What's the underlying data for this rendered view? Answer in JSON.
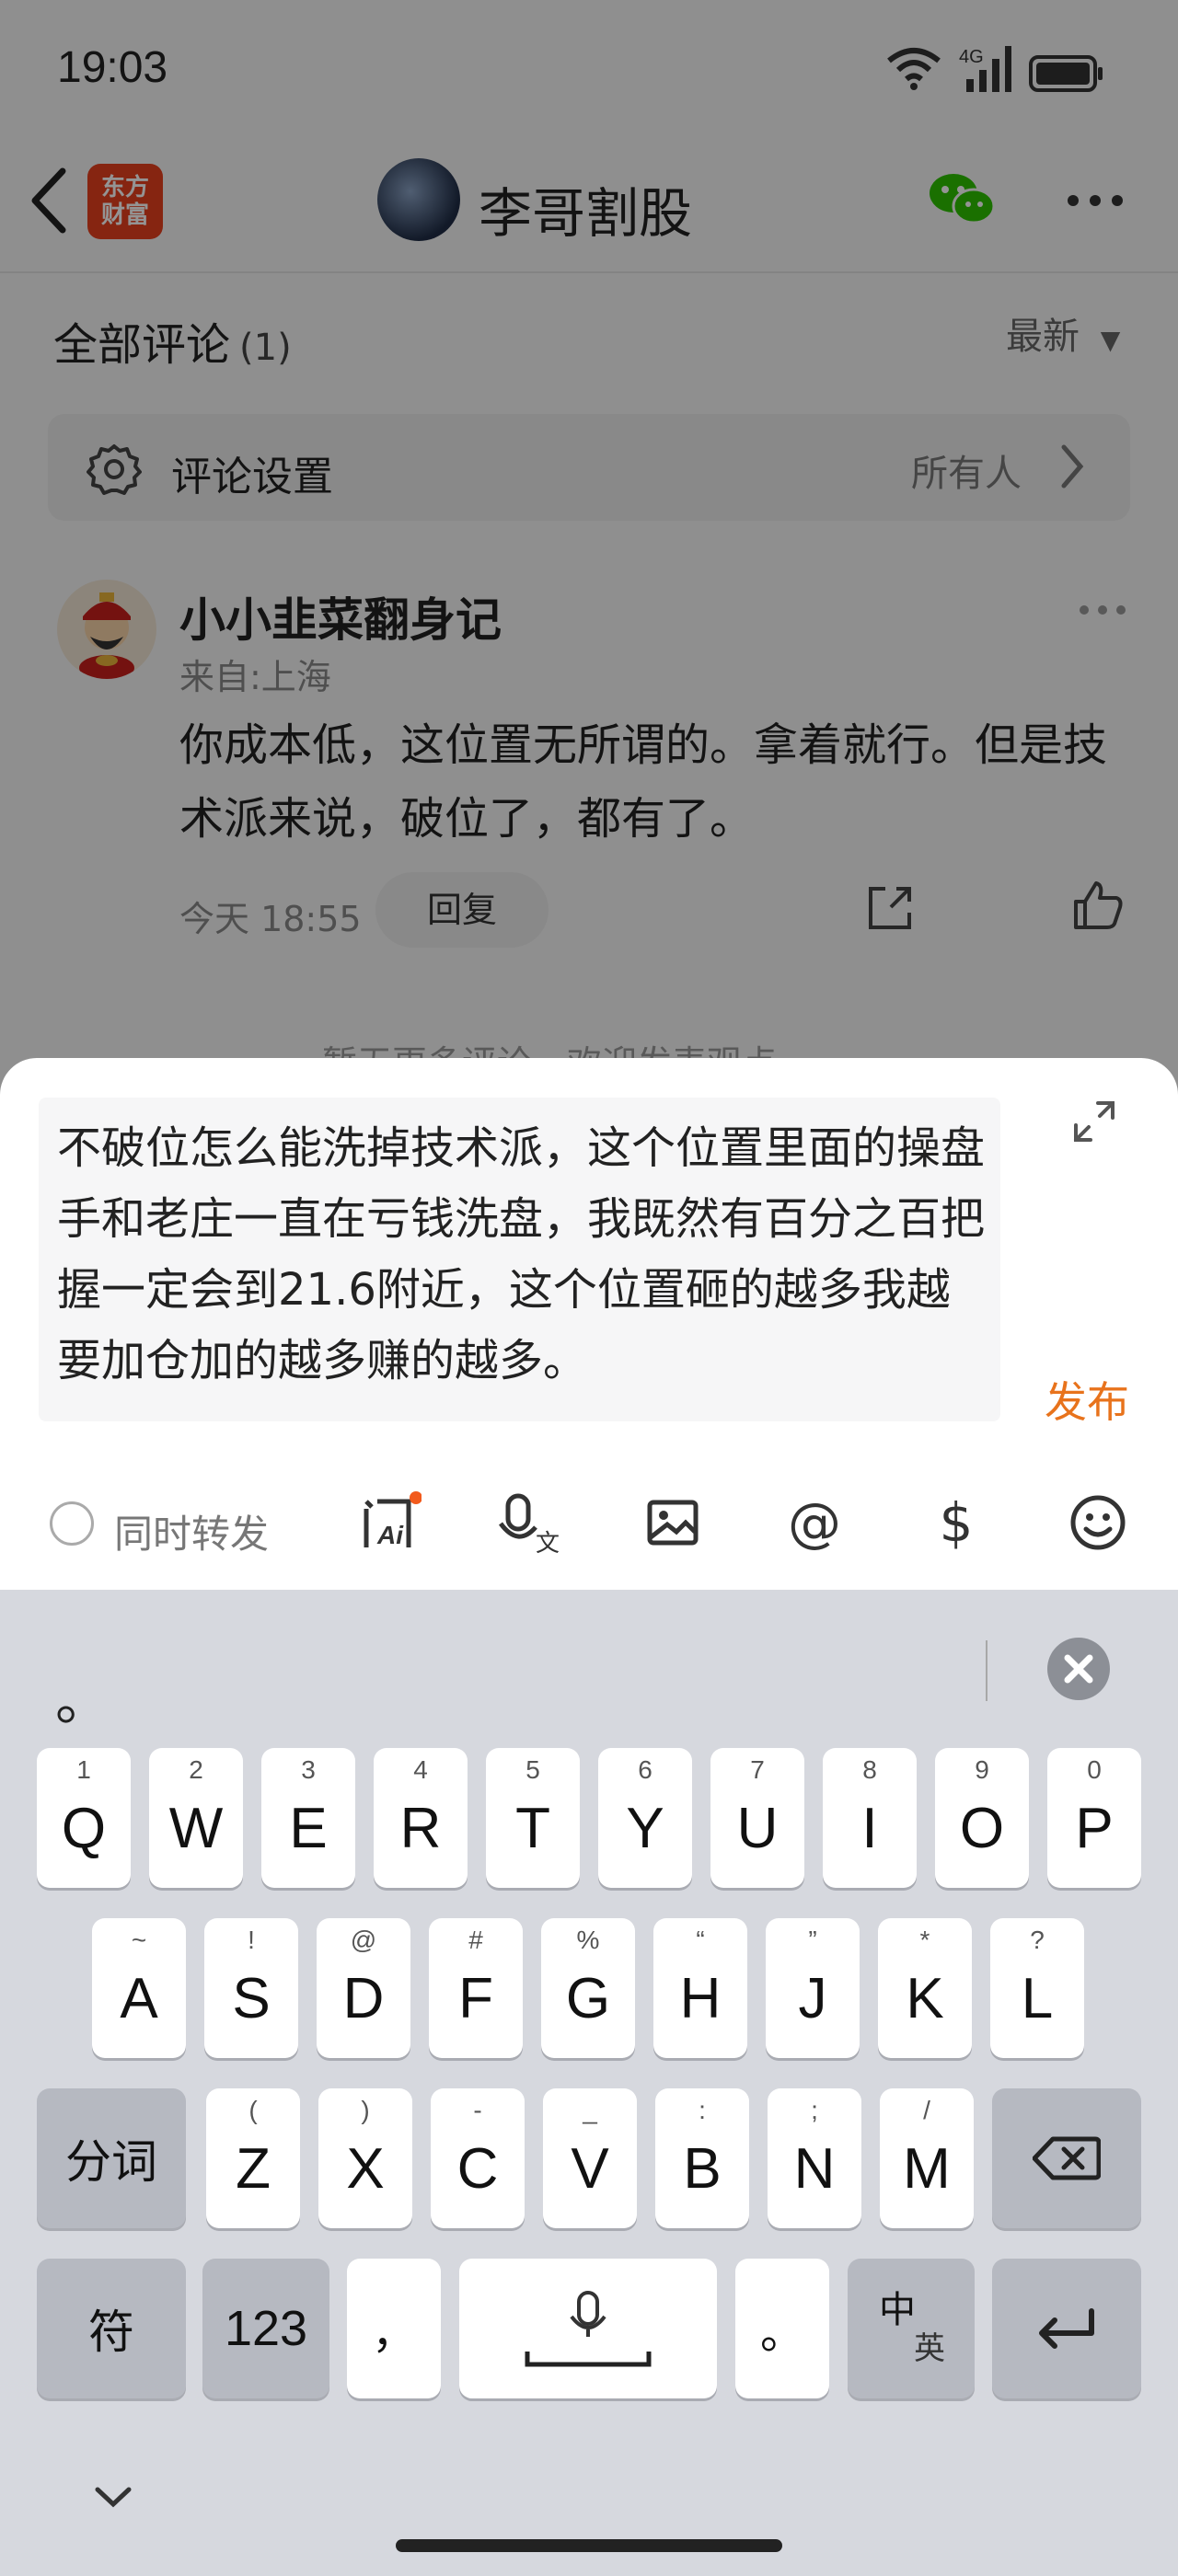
{
  "status_bar": {
    "time": "19:03",
    "network": "4G"
  },
  "nav": {
    "logo_line1": "东方",
    "logo_line2": "财富",
    "title": "李哥割股"
  },
  "comments": {
    "section_title": "全部评论",
    "count": "(1)",
    "sort_label": "最新",
    "settings_label": "评论设置",
    "settings_value": "所有人",
    "items": [
      {
        "name": "小小韭菜翻身记",
        "location": "来自:上海",
        "text": "你成本低，这位置无所谓的。拿着就行。但是技术派来说，破位了，都有了。",
        "time": "今天 18:55",
        "reply_label": "回复"
      }
    ],
    "no_more": "暂无更多评论，欢迎发表观点"
  },
  "composer": {
    "text": "不破位怎么能洗掉技术派，这个位置里面的操盘手和老庄一直在亏钱洗盘，我既然有百分之百把握一定会到21.6附近，这个位置砸的越多我越要加仓加的越多赚的越多。",
    "publish_label": "发布",
    "repost_label": "同时转发",
    "tools": [
      "ai-ask-icon",
      "voice-translate-icon",
      "image-icon",
      "at-icon",
      "dollar-icon",
      "emoji-icon"
    ],
    "accent_color": "#e8731c"
  },
  "keyboard": {
    "candidate": "。",
    "row1": [
      {
        "k": "Q",
        "h": "1"
      },
      {
        "k": "W",
        "h": "2"
      },
      {
        "k": "E",
        "h": "3"
      },
      {
        "k": "R",
        "h": "4"
      },
      {
        "k": "T",
        "h": "5"
      },
      {
        "k": "Y",
        "h": "6"
      },
      {
        "k": "U",
        "h": "7"
      },
      {
        "k": "I",
        "h": "8"
      },
      {
        "k": "O",
        "h": "9"
      },
      {
        "k": "P",
        "h": "0"
      }
    ],
    "row2": [
      {
        "k": "A",
        "h": "~"
      },
      {
        "k": "S",
        "h": "!"
      },
      {
        "k": "D",
        "h": "@"
      },
      {
        "k": "F",
        "h": "#"
      },
      {
        "k": "G",
        "h": "%"
      },
      {
        "k": "H",
        "h": "“"
      },
      {
        "k": "J",
        "h": "”"
      },
      {
        "k": "K",
        "h": "*"
      },
      {
        "k": "L",
        "h": "?"
      }
    ],
    "row3": [
      {
        "k": "Z",
        "h": "("
      },
      {
        "k": "X",
        "h": ")"
      },
      {
        "k": "C",
        "h": "-"
      },
      {
        "k": "V",
        "h": "_"
      },
      {
        "k": "B",
        "h": ":"
      },
      {
        "k": "N",
        "h": ";"
      },
      {
        "k": "M",
        "h": "/"
      }
    ],
    "segment_label": "分词",
    "symbol_label": "符",
    "numbers_label": "123",
    "comma_label": "，",
    "period_label": "。",
    "lang_cn": "中",
    "lang_en": "英"
  }
}
